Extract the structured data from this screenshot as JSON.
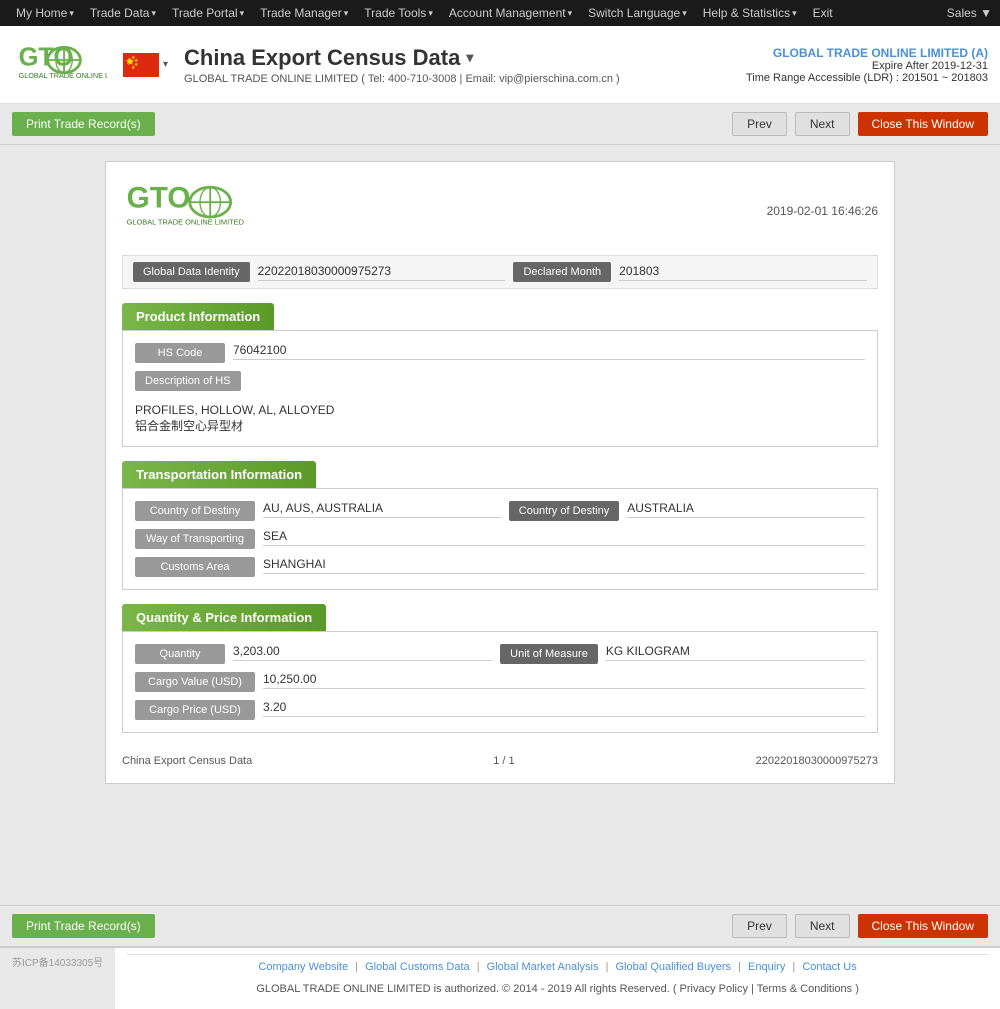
{
  "topnav": {
    "items": [
      {
        "label": "My Home",
        "arrow": true
      },
      {
        "label": "Trade Data",
        "arrow": true
      },
      {
        "label": "Trade Portal",
        "arrow": true
      },
      {
        "label": "Trade Manager",
        "arrow": true
      },
      {
        "label": "Trade Tools",
        "arrow": true
      },
      {
        "label": "Account Management",
        "arrow": true
      },
      {
        "label": "Switch Language",
        "arrow": true
      },
      {
        "label": "Help & Statistics",
        "arrow": true
      },
      {
        "label": "Exit",
        "arrow": false
      }
    ],
    "right": "Sales ▼"
  },
  "header": {
    "company": "GLOBAL TRADE ONLINE LIMITED (A)",
    "expire": "Expire After 2019-12-31",
    "ldr": "Time Range Accessible (LDR) : 201501 ~ 201803",
    "title": "China Export Census Data",
    "subtitle": "GLOBAL TRADE ONLINE LIMITED ( Tel: 400-710-3008 | Email: vip@pierschina.com.cn )"
  },
  "toolbar": {
    "print_label": "Print Trade Record(s)",
    "prev_label": "Prev",
    "next_label": "Next",
    "close_label": "Close This Window"
  },
  "record": {
    "datetime": "2019-02-01 16:46:26",
    "global_data_identity_label": "Global Data Identity",
    "global_data_identity_value": "22022018030000975273",
    "declared_month_label": "Declared Month",
    "declared_month_value": "201803",
    "sections": {
      "product": {
        "title": "Product Information",
        "hs_code_label": "HS Code",
        "hs_code_value": "76042100",
        "desc_hs_label": "Description of HS",
        "desc_hs_value": "PROFILES, HOLLOW, AL, ALLOYED",
        "desc_hs_cn": "铝合金制空心异型材"
      },
      "transportation": {
        "title": "Transportation Information",
        "country_dest_label": "Country of Destiny",
        "country_dest_value": "AU, AUS, AUSTRALIA",
        "country_dest2_label": "Country of Destiny",
        "country_dest2_value": "AUSTRALIA",
        "way_transport_label": "Way of Transporting",
        "way_transport_value": "SEA",
        "customs_area_label": "Customs Area",
        "customs_area_value": "SHANGHAI"
      },
      "quantity": {
        "title": "Quantity & Price Information",
        "quantity_label": "Quantity",
        "quantity_value": "3,203.00",
        "unit_label": "Unit of Measure",
        "unit_value": "KG KILOGRAM",
        "cargo_value_label": "Cargo Value (USD)",
        "cargo_value_value": "10,250.00",
        "cargo_price_label": "Cargo Price (USD)",
        "cargo_price_value": "3.20"
      }
    },
    "footer": {
      "left": "China Export Census Data",
      "center": "1 / 1",
      "right": "22022018030000975273"
    }
  },
  "page_footer": {
    "links": [
      {
        "label": "Company Website"
      },
      {
        "label": "Global Customs Data"
      },
      {
        "label": "Global Market Analysis"
      },
      {
        "label": "Global Qualified Buyers"
      },
      {
        "label": "Enquiry"
      },
      {
        "label": "Contact Us"
      }
    ],
    "copyright": "GLOBAL TRADE ONLINE LIMITED is authorized. © 2014 - 2019 All rights Reserved.  (  Privacy Policy  |  Terms & Conditions  )",
    "icp": "苏ICP备14033305号"
  }
}
